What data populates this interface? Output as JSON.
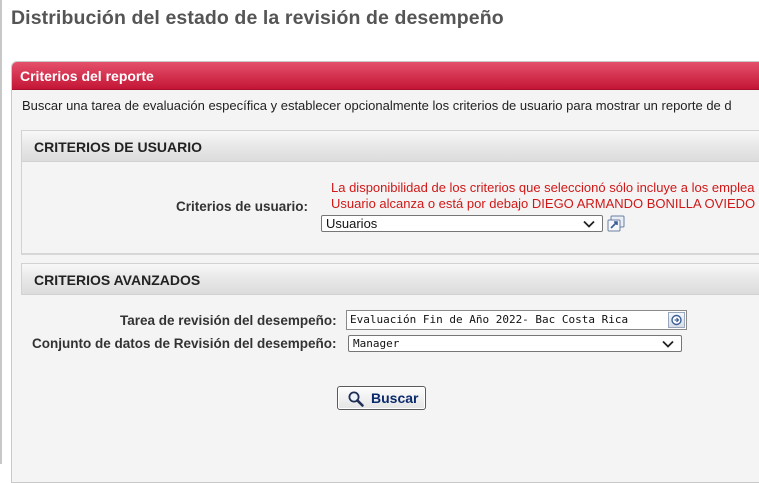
{
  "page": {
    "title": "Distribución del estado de la revisión de desempeño"
  },
  "panel": {
    "title": "Criterios del reporte",
    "description": "Buscar una tarea de evaluación específica y establecer opcionalmente los criterios de usuario para mostrar un reporte de d"
  },
  "user_criteria": {
    "section_title": "CRITERIOS DE USUARIO",
    "label": "Criterios de usuario:",
    "warning_line1": "La disponibilidad de los criterios que seleccionó sólo incluye a los emplea",
    "warning_line2": "Usuario alcanza o está por debajo DIEGO ARMANDO BONILLA OVIEDO",
    "select_value": "Usuarios"
  },
  "advanced_criteria": {
    "section_title": "CRITERIOS AVANZADOS",
    "task_label": "Tarea de revisión del desempeño:",
    "task_value": "Evaluación Fin de Año 2022- Bac Costa Rica",
    "dataset_label": "Conjunto de datos de Revisión del desempeño:",
    "dataset_value": "Manager"
  },
  "actions": {
    "search_label": "Buscar"
  },
  "colors": {
    "header_red": "#c41636",
    "warning_red": "#d01818",
    "button_text_navy": "#0b2a6b"
  },
  "icons": {
    "user_lookup": "user-lookup-icon",
    "task_lookup": "lookup-icon",
    "search": "magnifier-icon",
    "dropdown": "chevron-down-icon"
  }
}
